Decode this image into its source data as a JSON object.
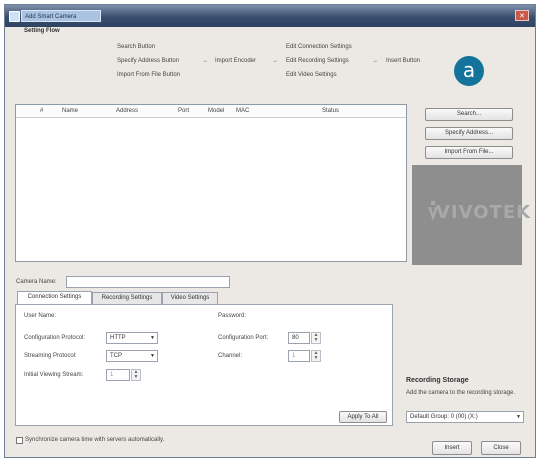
{
  "window": {
    "title": "Add Smart Camera",
    "close_glyph": "✕"
  },
  "badge": "a",
  "setting_flow": {
    "heading": "Setting Flow",
    "col1": [
      "Search Button",
      "Specify Address Button",
      "Import From File Button"
    ],
    "import_encoder": "Import Encoder",
    "col3": [
      "Edit Connection Settings",
      "Edit Recording Settings",
      "Edit Video Settings"
    ],
    "insert_button": "Insert Button",
    "arrow": "→"
  },
  "device_list": {
    "columns": [
      "#",
      "Name",
      "Address",
      "Port",
      "Model",
      "MAC",
      "Status"
    ]
  },
  "side_buttons": {
    "search": "Search...",
    "specify_address": "Specify Address...",
    "import_from_file": "Import From File..."
  },
  "logo_text": "VIVOTEK",
  "camera_name": {
    "label": "Camera Name:",
    "value": ""
  },
  "tabs": [
    "Connection Settings",
    "Recording Settings",
    "Video Settings"
  ],
  "connection": {
    "user_name_label": "User Name:",
    "password_label": "Password:",
    "config_protocol_label": "Configuration Protocol:",
    "config_protocol_value": "HTTP",
    "config_port_label": "Configuration Port:",
    "config_port_value": "80",
    "streaming_protocol_label": "Streaming Protocol:",
    "streaming_protocol_value": "TCP",
    "channel_label": "Channel:",
    "channel_value": "1",
    "initial_stream_label": "Initial Viewing Stream:",
    "initial_stream_value": "1",
    "apply_all": "Apply To All"
  },
  "recording_storage": {
    "heading": "Recording Storage",
    "description": "Add the camera to the recording storage.",
    "selected": "Default Group: 0 (00) (X:)"
  },
  "footer": {
    "sync_checkbox": "Synchronize camera time with servers automatically.",
    "insert": "Insert",
    "close": "Close"
  }
}
